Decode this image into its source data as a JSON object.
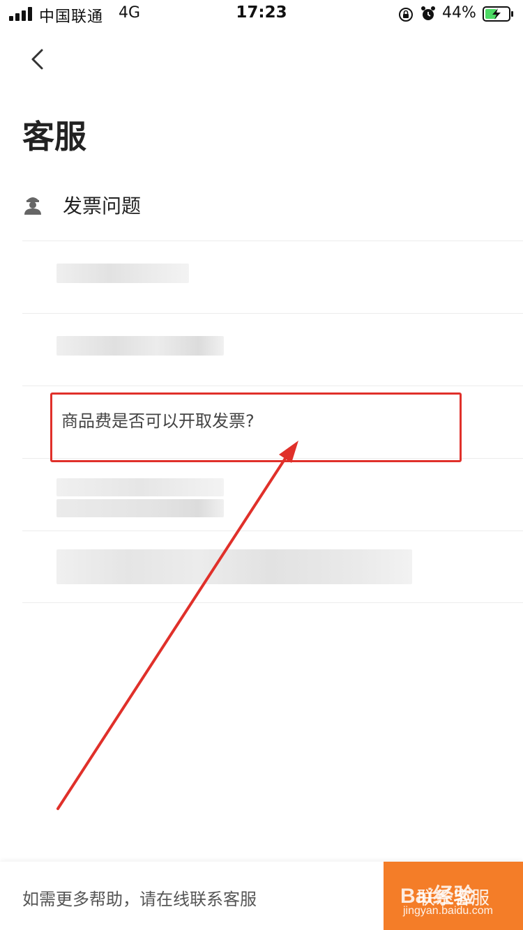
{
  "status_bar": {
    "carrier": "中国联通",
    "network": "4G",
    "time": "17:23",
    "battery_percent": "44%",
    "icons": [
      "signal-icon",
      "lock-rotation-icon",
      "alarm-icon",
      "battery-charging-icon"
    ]
  },
  "header": {
    "back_icon": "chevron-left-icon",
    "title": "客服"
  },
  "section": {
    "icon": "agent-icon",
    "label": "发票问题"
  },
  "faq": {
    "items": [
      {
        "text": "",
        "blurred": true
      },
      {
        "text": "",
        "blurred": true
      },
      {
        "text": "商品费是否可以开取发票?",
        "blurred": false,
        "highlighted": true
      },
      {
        "text": "",
        "blurred": true
      },
      {
        "text": "",
        "blurred": true
      }
    ]
  },
  "footer": {
    "help_text": "如需更多帮助，请在线联系客服",
    "contact_label": "联系客服"
  },
  "watermark": {
    "logo": "Bai经验",
    "url": "jingyan.baidu.com"
  },
  "colors": {
    "accent": "#f47d28",
    "annotation": "#e0302a"
  }
}
